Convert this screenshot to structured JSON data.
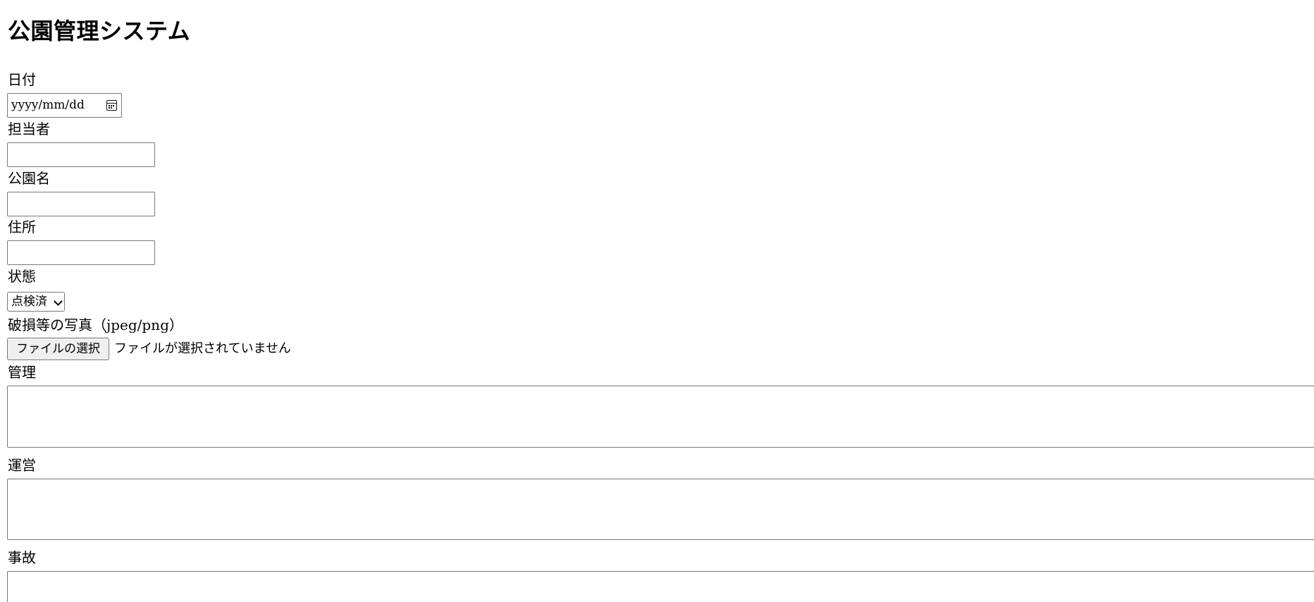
{
  "page": {
    "title": "公園管理システム"
  },
  "form": {
    "date": {
      "label": "日付",
      "placeholder": "yyyy/mm/dd",
      "icon": "calendar-icon"
    },
    "person": {
      "label": "担当者",
      "value": ""
    },
    "park_name": {
      "label": "公園名",
      "value": ""
    },
    "address": {
      "label": "住所",
      "value": ""
    },
    "status": {
      "label": "状態",
      "selected": "点検済",
      "icon": "chevron-down-icon"
    },
    "photo": {
      "label": "破損等の写真（jpeg/png）",
      "button_label": "ファイルの選択",
      "status_text": "ファイルが選択されていません"
    },
    "management": {
      "label": "管理",
      "value": ""
    },
    "operation": {
      "label": "運営",
      "value": ""
    },
    "accident": {
      "label": "事故",
      "value": ""
    }
  }
}
